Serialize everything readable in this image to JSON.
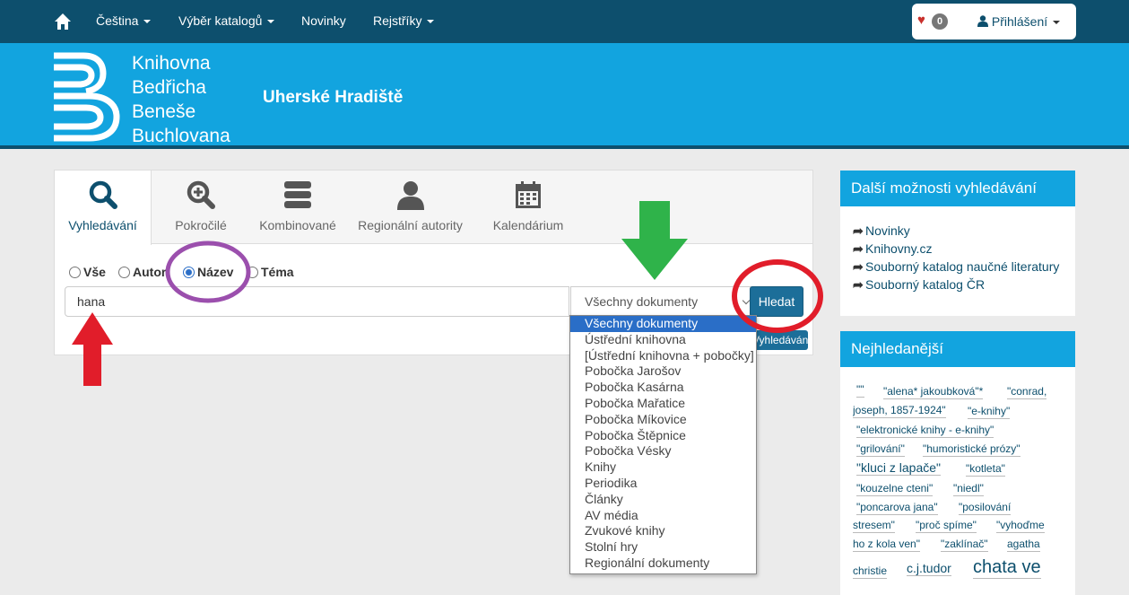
{
  "topnav": {
    "items": [
      {
        "label": "Čeština"
      },
      {
        "label": "Výběr katalogů"
      },
      {
        "label": "Novinky"
      },
      {
        "label": "Rejstříky"
      }
    ],
    "favorites_count": "0",
    "login_label": "Přihlášení"
  },
  "banner": {
    "logo_lines": [
      "Knihovna",
      "Bedřicha",
      "Beneše",
      "Buchlovana"
    ],
    "city": "Uherské Hradiště"
  },
  "search": {
    "tabs": [
      {
        "label": "Vyhledávání",
        "icon": "search-icon"
      },
      {
        "label": "Pokročilé",
        "icon": "zoom-plus-icon"
      },
      {
        "label": "Kombinované",
        "icon": "server-stack-icon"
      },
      {
        "label": "Regionální autority",
        "icon": "person-icon"
      },
      {
        "label": "Kalendárium",
        "icon": "calendar-icon"
      }
    ],
    "radios": [
      {
        "label": "Vše",
        "selected": false
      },
      {
        "label": "Autor",
        "selected": false
      },
      {
        "label": "Název",
        "selected": true
      },
      {
        "label": "Téma",
        "selected": false
      }
    ],
    "input_value": "hana",
    "doctype_value": "Všechny dokumenty",
    "search_button": "Hledat",
    "advanced_button": "Vyhledávání",
    "doctype_options": [
      "Všechny dokumenty",
      "Ústřední knihovna",
      "[Ústřední knihovna + pobočky]",
      "Pobočka Jarošov",
      "Pobočka Kasárna",
      "Pobočka Mařatice",
      "Pobočka Míkovice",
      "Pobočka Štěpnice",
      "Pobočka Vésky",
      "Knihy",
      "Periodika",
      "Články",
      "AV média",
      "Zvukové knihy",
      "Stolní hry",
      "Regionální dokumenty"
    ]
  },
  "sidebar": {
    "more_title": "Další možnosti vyhledávání",
    "more_links": [
      "Novinky",
      "Knihovny.cz",
      "Souborný katalog naučné literatury",
      "Souborný katalog ČR"
    ],
    "popular_title": "Nejhledanější",
    "tags": [
      "\"\"",
      "\"alena* jakoubková\"*",
      "\"conrad,",
      "joseph, 1857-1924\"",
      "\"e-knihy\"",
      "\"elektronické knihy - e-knihy\"",
      "\"grilování\"",
      "\"humoristické prózy\"",
      "\"kluci z lapače\"",
      "\"kotleta\"",
      "\"kouzelne cteni\"",
      "\"niedl\"",
      "\"poncarova jana\"",
      "\"posilování",
      "stresem\"",
      "\"proč spíme\"",
      "\"vyhoďme",
      "ho z kola ven\"",
      "\"zaklínač\"",
      "agatha",
      "christie",
      "c.j.tudor",
      "chata ve"
    ]
  },
  "colors": {
    "nav": "#0d4f6d",
    "banner": "#12a4df",
    "annotation_green": "#2fb34a",
    "annotation_red": "#e11d2a",
    "annotation_purple": "#9b4fad"
  }
}
